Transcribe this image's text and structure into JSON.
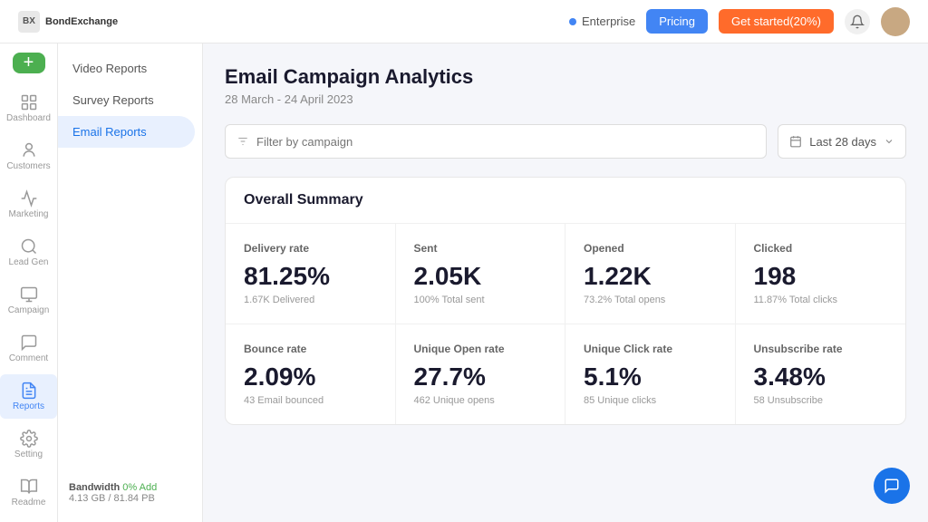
{
  "topbar": {
    "logo_text": "BondExchange",
    "enterprise_label": "Enterprise",
    "pricing_label": "Pricing",
    "get_started_label": "Get started(20%)"
  },
  "sidebar": {
    "add_icon": "+",
    "items": [
      {
        "id": "dashboard",
        "label": "Dashboard",
        "active": false
      },
      {
        "id": "customers",
        "label": "Customers",
        "active": false
      },
      {
        "id": "marketing",
        "label": "Marketing",
        "active": false
      },
      {
        "id": "lead-gen",
        "label": "Lead Gen",
        "active": false
      },
      {
        "id": "campaign",
        "label": "Campaign",
        "active": false
      },
      {
        "id": "comment",
        "label": "Comment",
        "active": false
      },
      {
        "id": "reports",
        "label": "Reports",
        "active": true
      },
      {
        "id": "setting",
        "label": "Setting",
        "active": false
      },
      {
        "id": "readme",
        "label": "Readme",
        "active": false
      }
    ]
  },
  "left_nav": {
    "items": [
      {
        "id": "video-reports",
        "label": "Video Reports",
        "active": false
      },
      {
        "id": "survey-reports",
        "label": "Survey Reports",
        "active": false
      },
      {
        "id": "email-reports",
        "label": "Email Reports",
        "active": true
      }
    ]
  },
  "main": {
    "page_title": "Email Campaign Analytics",
    "page_subtitle": "28 March - 24 April 2023",
    "filter_placeholder": "Filter by campaign",
    "date_range_label": "Last 28 days",
    "summary": {
      "title": "Overall Summary",
      "metrics": [
        {
          "label": "Delivery rate",
          "value": "81.25%",
          "sub": "1.67K Delivered"
        },
        {
          "label": "Sent",
          "value": "2.05K",
          "sub": "100% Total sent"
        },
        {
          "label": "Opened",
          "value": "1.22K",
          "sub": "73.2% Total opens"
        },
        {
          "label": "Clicked",
          "value": "198",
          "sub": "11.87% Total clicks"
        },
        {
          "label": "Bounce rate",
          "value": "2.09%",
          "sub": "43 Email bounced"
        },
        {
          "label": "Unique Open rate",
          "value": "27.7%",
          "sub": "462 Unique opens"
        },
        {
          "label": "Unique Click rate",
          "value": "5.1%",
          "sub": "85 Unique clicks"
        },
        {
          "label": "Unsubscribe rate",
          "value": "3.48%",
          "sub": "58 Unsubscribe"
        }
      ]
    }
  },
  "bandwidth": {
    "label": "Bandwidth",
    "highlight": "0% Add",
    "value": "4.13 GB / 81.84 PB"
  }
}
